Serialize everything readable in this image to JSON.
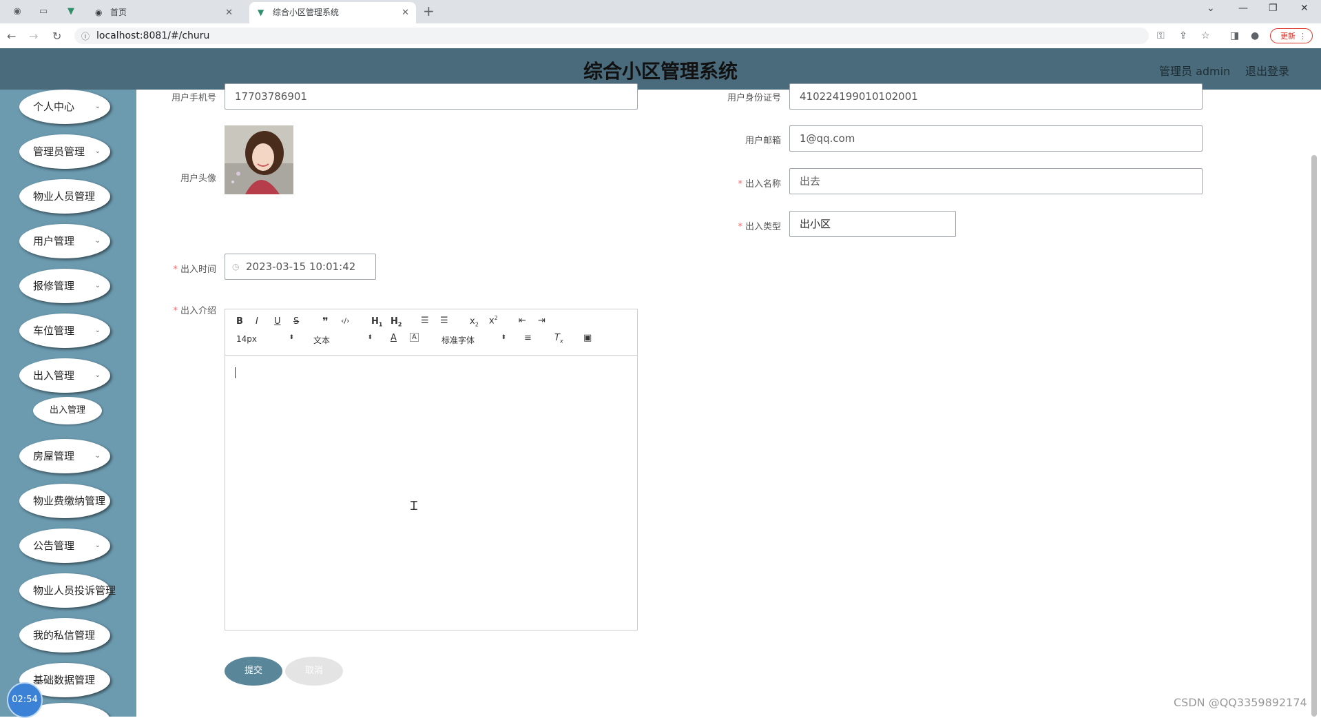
{
  "browser": {
    "tabs": [
      {
        "label": "首页",
        "active": false
      },
      {
        "label": "综合小区管理系统",
        "active": true
      }
    ],
    "url": "localhost:8081/#/churu",
    "update_label": "更新"
  },
  "header": {
    "title": "综合小区管理系统",
    "user": "管理员 admin",
    "logout": "退出登录"
  },
  "sidebar": {
    "items": [
      {
        "label": "个人中心"
      },
      {
        "label": "管理员管理"
      },
      {
        "label": "物业人员管理"
      },
      {
        "label": "用户管理"
      },
      {
        "label": "报修管理"
      },
      {
        "label": "车位管理"
      },
      {
        "label": "出入管理"
      },
      {
        "label": "房屋管理"
      },
      {
        "label": "物业费缴纳管理"
      },
      {
        "label": "公告管理"
      },
      {
        "label": "物业人员投诉管理"
      },
      {
        "label": "我的私信管理"
      },
      {
        "label": "基础数据管理"
      }
    ],
    "sub_item": "出入管理",
    "clock": "02:54"
  },
  "form": {
    "phone": {
      "label": "用户手机号",
      "value": "17703786901"
    },
    "id_card": {
      "label": "用户身份证号",
      "value": "410224199010102001"
    },
    "avatar": {
      "label": "用户头像"
    },
    "email": {
      "label": "用户邮箱",
      "value": "1@qq.com"
    },
    "name": {
      "label": "出入名称",
      "value": "出去"
    },
    "type": {
      "label": "出入类型",
      "value": "出小区"
    },
    "time": {
      "label": "出入时间",
      "value": "2023-03-15 10:01:42"
    },
    "intro": {
      "label": "出入介绍"
    },
    "required_mark": "*"
  },
  "editor": {
    "font_size": "14px",
    "block_format": "文本",
    "font_family": "标准字体"
  },
  "buttons": {
    "submit": "提交",
    "cancel": "取消"
  },
  "watermark": "CSDN @QQ3359892174",
  "colors": {
    "header_bg": "#4a6b7c",
    "sidebar_bg": "#6c9bb0",
    "submit_bg": "#5a8699",
    "required": "#f56c6c"
  }
}
